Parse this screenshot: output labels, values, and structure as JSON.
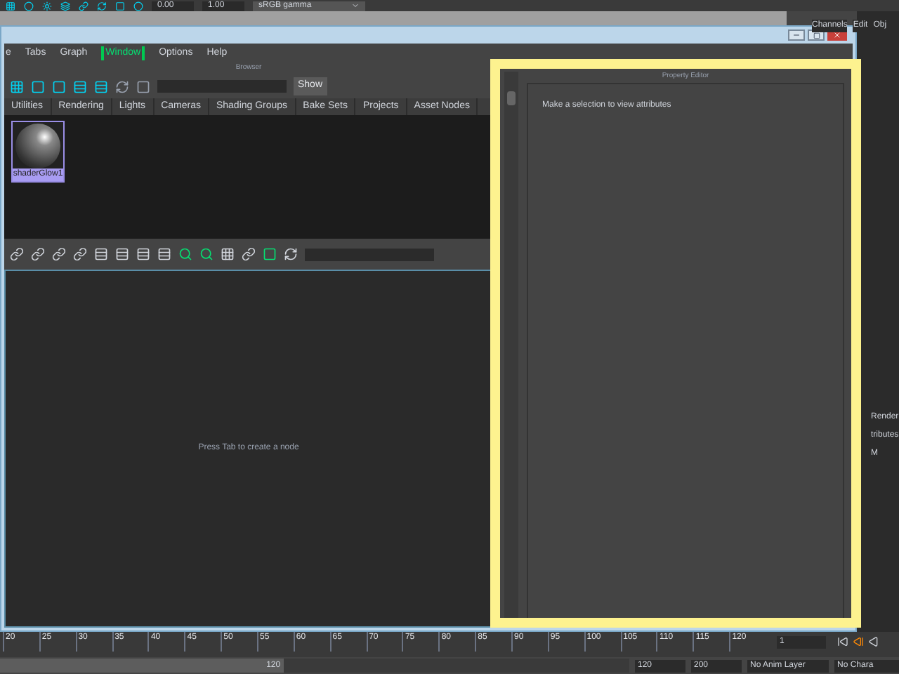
{
  "top_toolbar": {
    "fields": [
      "0.00",
      "1.00"
    ],
    "color_space": "sRGB gamma"
  },
  "channel_box_menu": [
    "Channels",
    "Edit",
    "Obj"
  ],
  "window": {
    "menu": [
      {
        "label": "e",
        "highlighted": false
      },
      {
        "label": "Tabs",
        "highlighted": false
      },
      {
        "label": "Graph",
        "highlighted": false
      },
      {
        "label": "Window",
        "highlighted": true
      },
      {
        "label": "Options",
        "highlighted": false
      },
      {
        "label": "Help",
        "highlighted": false
      }
    ]
  },
  "browser": {
    "title": "Browser",
    "show_button": "Show",
    "tabs": [
      "Utilities",
      "Rendering",
      "Lights",
      "Cameras",
      "Shading Groups",
      "Bake Sets",
      "Projects",
      "Asset Nodes"
    ],
    "swatches": [
      {
        "label": "shaderGlow1",
        "selected": true
      }
    ]
  },
  "graph": {
    "hint": "Press Tab to create a node"
  },
  "property_editor": {
    "title": "Property Editor",
    "message": "Make a selection to view attributes"
  },
  "side_panel": [
    "Render",
    "tributes",
    "M"
  ],
  "timeline": {
    "ticks": [
      "20",
      "25",
      "30",
      "35",
      "40",
      "45",
      "50",
      "55",
      "60",
      "65",
      "70",
      "75",
      "80",
      "85",
      "90",
      "95",
      "100",
      "105",
      "110",
      "115",
      "120"
    ],
    "current_frame": "1"
  },
  "range": {
    "level": 0.45,
    "end_label": "120",
    "start": "120",
    "end": "200",
    "anim_layer": "No Anim Layer",
    "character": "No Chara"
  }
}
